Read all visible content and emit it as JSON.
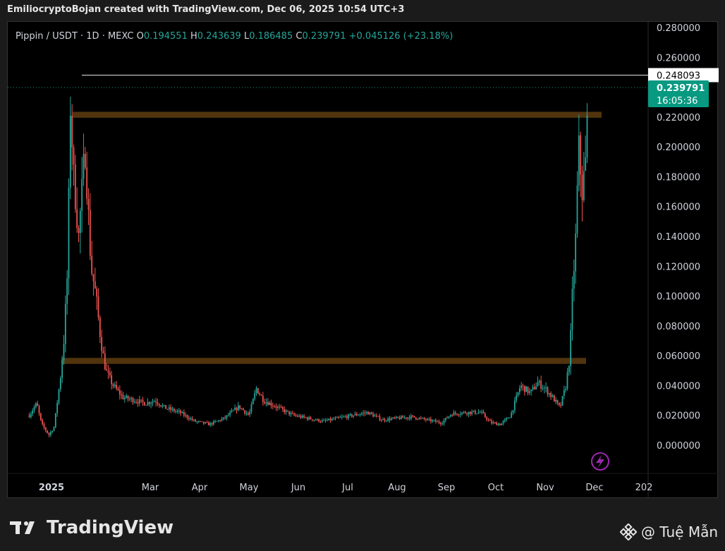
{
  "header": {
    "created_by": "EmiliocryptoBojan created with TradingView.com, Dec 06, 2025 10:54 UTC+3"
  },
  "legend": {
    "symbol": "Pippin / USDT · 1D · MEXC",
    "o_label": "O",
    "o_value": "0.194551",
    "h_label": "H",
    "h_value": "0.243639",
    "l_label": "L",
    "l_value": "0.186485",
    "c_label": "C",
    "c_value": "0.239791",
    "change": "+0.045126 (+23.18%)"
  },
  "footer": {
    "brand": "TradingView",
    "credit": "@ Tuệ Mẫn"
  },
  "chart_data": {
    "type": "candlestick",
    "y_axis_labels": [
      "0.280000",
      "0.260000",
      "0.220000",
      "0.200000",
      "0.180000",
      "0.160000",
      "0.140000",
      "0.120000",
      "0.100000",
      "0.080000",
      "0.060000",
      "0.040000",
      "0.020000",
      "0.000000"
    ],
    "y_axis_values": [
      0.28,
      0.26,
      0.22,
      0.2,
      0.18,
      0.16,
      0.14,
      0.12,
      0.1,
      0.08,
      0.06,
      0.04,
      0.02,
      0.0
    ],
    "ylim": [
      0.0,
      0.28
    ],
    "x_axis_labels": [
      "2025",
      "Mar",
      "Apr",
      "May",
      "Jun",
      "Jul",
      "Aug",
      "Sep",
      "Oct",
      "Nov",
      "Dec",
      "202"
    ],
    "x_axis_months": [
      0,
      2,
      3,
      4,
      5,
      6,
      7,
      8,
      9,
      10,
      11,
      12
    ],
    "horizontal_line": {
      "value": 0.248093,
      "label": "0.248093"
    },
    "last_price": {
      "value": 0.239791,
      "label": "0.239791",
      "countdown": "16:05:36",
      "color": "#089981"
    },
    "zones": [
      {
        "from": 0.2195,
        "to": 0.2235,
        "color": "#5a3a10"
      },
      {
        "from": 0.0545,
        "to": 0.0585,
        "color": "#5a3a10"
      }
    ],
    "up_color": "#26a69a",
    "down_color": "#ef5350",
    "price_path": [
      [
        -0.45,
        0.02
      ],
      [
        -0.3,
        0.028
      ],
      [
        -0.2,
        0.014
      ],
      [
        -0.05,
        0.007
      ],
      [
        0.05,
        0.012
      ],
      [
        0.18,
        0.045
      ],
      [
        0.25,
        0.07
      ],
      [
        0.33,
        0.12
      ],
      [
        0.38,
        0.23
      ],
      [
        0.45,
        0.18
      ],
      [
        0.55,
        0.14
      ],
      [
        0.68,
        0.2
      ],
      [
        0.8,
        0.12
      ],
      [
        0.9,
        0.1
      ],
      [
        1.0,
        0.07
      ],
      [
        1.1,
        0.05
      ],
      [
        1.25,
        0.04
      ],
      [
        1.45,
        0.032
      ],
      [
        1.7,
        0.03
      ],
      [
        1.9,
        0.028
      ],
      [
        2.1,
        0.03
      ],
      [
        2.3,
        0.025
      ],
      [
        2.6,
        0.022
      ],
      [
        2.9,
        0.016
      ],
      [
        3.2,
        0.014
      ],
      [
        3.5,
        0.018
      ],
      [
        3.8,
        0.026
      ],
      [
        4.0,
        0.02
      ],
      [
        4.15,
        0.038
      ],
      [
        4.3,
        0.03
      ],
      [
        4.6,
        0.025
      ],
      [
        4.9,
        0.02
      ],
      [
        5.2,
        0.018
      ],
      [
        5.5,
        0.016
      ],
      [
        5.8,
        0.018
      ],
      [
        6.1,
        0.02
      ],
      [
        6.4,
        0.022
      ],
      [
        6.7,
        0.017
      ],
      [
        7.0,
        0.018
      ],
      [
        7.3,
        0.019
      ],
      [
        7.6,
        0.017
      ],
      [
        7.9,
        0.015
      ],
      [
        8.1,
        0.021
      ],
      [
        8.4,
        0.022
      ],
      [
        8.7,
        0.022
      ],
      [
        8.9,
        0.015
      ],
      [
        9.1,
        0.014
      ],
      [
        9.3,
        0.02
      ],
      [
        9.5,
        0.04
      ],
      [
        9.7,
        0.035
      ],
      [
        9.85,
        0.042
      ],
      [
        10.0,
        0.038
      ],
      [
        10.15,
        0.032
      ],
      [
        10.3,
        0.025
      ],
      [
        10.42,
        0.04
      ],
      [
        10.5,
        0.06
      ],
      [
        10.55,
        0.1
      ],
      [
        10.62,
        0.14
      ],
      [
        10.68,
        0.2
      ],
      [
        10.75,
        0.17
      ],
      [
        10.82,
        0.19
      ],
      [
        10.88,
        0.24
      ]
    ]
  }
}
